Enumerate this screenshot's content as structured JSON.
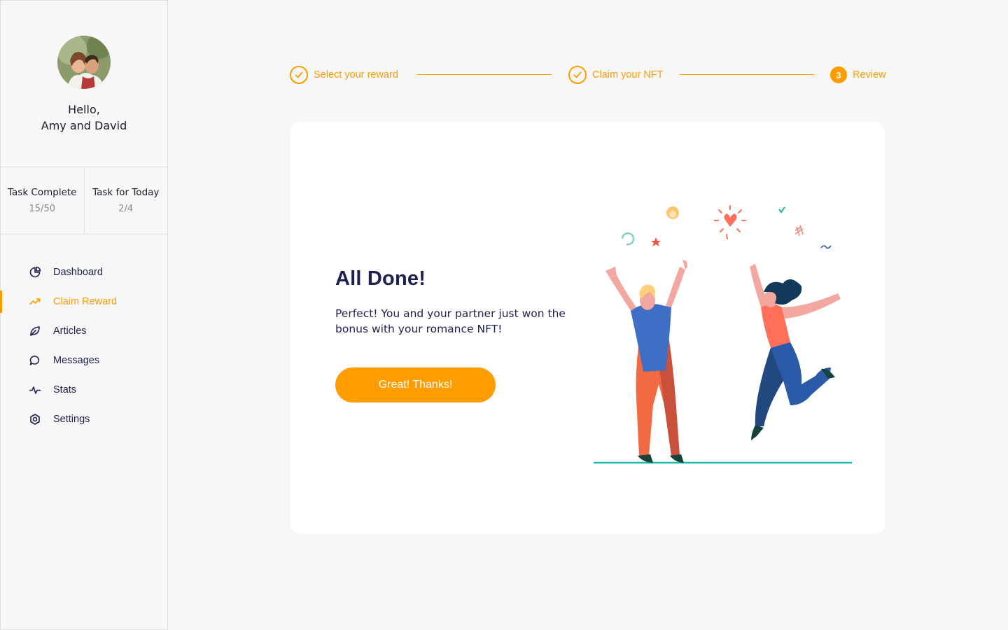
{
  "sidebar": {
    "greeting_line1": "Hello,",
    "greeting_line2": "Amy and David",
    "stats": [
      {
        "label": "Task Complete",
        "value": "15/50"
      },
      {
        "label": "Task for Today",
        "value": "2/4"
      }
    ],
    "nav": [
      {
        "label": "Dashboard",
        "icon": "pie-chart-icon",
        "active": false
      },
      {
        "label": "Claim Reward",
        "icon": "trending-up-icon",
        "active": true
      },
      {
        "label": "Articles",
        "icon": "leaf-icon",
        "active": false
      },
      {
        "label": "Messages",
        "icon": "chat-bubble-icon",
        "active": false
      },
      {
        "label": "Stats",
        "icon": "pulse-icon",
        "active": false
      },
      {
        "label": "Settings",
        "icon": "gear-icon",
        "active": false
      }
    ]
  },
  "stepper": {
    "steps": [
      {
        "label": "Select your reward",
        "state": "done"
      },
      {
        "label": "Claim your NFT",
        "state": "done"
      },
      {
        "number": "3",
        "label": "Review",
        "state": "current"
      }
    ]
  },
  "card": {
    "title": "All Done!",
    "text": "Perfect! You and your partner just won the bonus with your romance NFT!",
    "button_label": "Great! Thanks!"
  },
  "colors": {
    "accent": "#ff9c00",
    "navy": "#1f2050",
    "background": "#f7f7f7",
    "card": "#ffffff"
  }
}
